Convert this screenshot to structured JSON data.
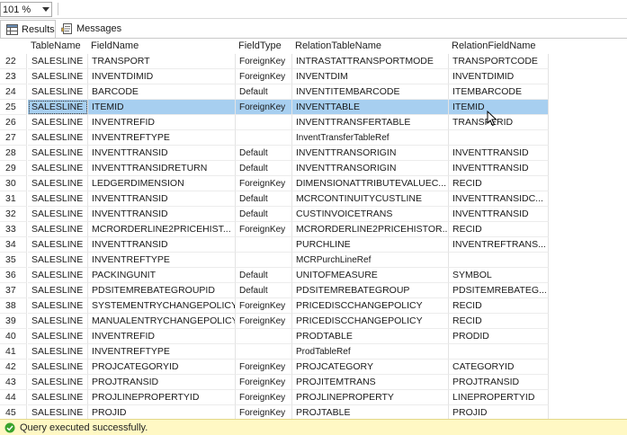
{
  "zoom": {
    "value": "101 %"
  },
  "tabs": {
    "results": "Results",
    "messages": "Messages"
  },
  "columns": [
    "TableName",
    "FieldName",
    "FieldType",
    "RelationTableName",
    "RelationFieldName"
  ],
  "rows": [
    {
      "n": "22",
      "t": "SALESLINE",
      "f": "TRANSPORT",
      "ft": "ForeignKey",
      "rt": "INTRASTATTRANSPORTMODE",
      "rf": "TRANSPORTCODE"
    },
    {
      "n": "23",
      "t": "SALESLINE",
      "f": "INVENTDIMID",
      "ft": "ForeignKey",
      "rt": "INVENTDIM",
      "rf": "INVENTDIMID"
    },
    {
      "n": "24",
      "t": "SALESLINE",
      "f": "BARCODE",
      "ft": "Default",
      "rt": "INVENTITEMBARCODE",
      "rf": "ITEMBARCODE"
    },
    {
      "n": "25",
      "t": "SALESLINE",
      "f": "ITEMID",
      "ft": "ForeignKey",
      "rt": "INVENTTABLE",
      "rf": "ITEMID",
      "sel": true
    },
    {
      "n": "26",
      "t": "SALESLINE",
      "f": "INVENTREFID",
      "ft": "",
      "rt": "INVENTTRANSFERTABLE",
      "rf": "TRANSFERID"
    },
    {
      "n": "27",
      "t": "SALESLINE",
      "f": "INVENTREFTYPE",
      "ft": "",
      "rt": "InventTransferTableRef",
      "rf": ""
    },
    {
      "n": "28",
      "t": "SALESLINE",
      "f": "INVENTTRANSID",
      "ft": "Default",
      "rt": "INVENTTRANSORIGIN",
      "rf": "INVENTTRANSID"
    },
    {
      "n": "29",
      "t": "SALESLINE",
      "f": "INVENTTRANSIDRETURN",
      "ft": "Default",
      "rt": "INVENTTRANSORIGIN",
      "rf": "INVENTTRANSID"
    },
    {
      "n": "30",
      "t": "SALESLINE",
      "f": "LEDGERDIMENSION",
      "ft": "ForeignKey",
      "rt": "DIMENSIONATTRIBUTEVALUEC...",
      "rf": "RECID"
    },
    {
      "n": "31",
      "t": "SALESLINE",
      "f": "INVENTTRANSID",
      "ft": "Default",
      "rt": "MCRCONTINUITYCUSTLINE",
      "rf": "INVENTTRANSIDC..."
    },
    {
      "n": "32",
      "t": "SALESLINE",
      "f": "INVENTTRANSID",
      "ft": "Default",
      "rt": "CUSTINVOICETRANS",
      "rf": "INVENTTRANSID"
    },
    {
      "n": "33",
      "t": "SALESLINE",
      "f": "MCRORDERLINE2PRICEHIST...",
      "ft": "ForeignKey",
      "rt": "MCRORDERLINE2PRICEHISTOR...",
      "rf": "RECID"
    },
    {
      "n": "34",
      "t": "SALESLINE",
      "f": "INVENTTRANSID",
      "ft": "",
      "rt": "PURCHLINE",
      "rf": "INVENTREFTRANS..."
    },
    {
      "n": "35",
      "t": "SALESLINE",
      "f": "INVENTREFTYPE",
      "ft": "",
      "rt": "MCRPurchLineRef",
      "rf": ""
    },
    {
      "n": "36",
      "t": "SALESLINE",
      "f": "PACKINGUNIT",
      "ft": "Default",
      "rt": "UNITOFMEASURE",
      "rf": "SYMBOL"
    },
    {
      "n": "37",
      "t": "SALESLINE",
      "f": "PDSITEMREBATEGROUPID",
      "ft": "Default",
      "rt": "PDSITEMREBATEGROUP",
      "rf": "PDSITEMREBATEG..."
    },
    {
      "n": "38",
      "t": "SALESLINE",
      "f": "SYSTEMENTRYCHANGEPOLICY",
      "ft": "ForeignKey",
      "rt": "PRICEDISCCHANGEPOLICY",
      "rf": "RECID"
    },
    {
      "n": "39",
      "t": "SALESLINE",
      "f": "MANUALENTRYCHANGEPOLICY",
      "ft": "ForeignKey",
      "rt": "PRICEDISCCHANGEPOLICY",
      "rf": "RECID"
    },
    {
      "n": "40",
      "t": "SALESLINE",
      "f": "INVENTREFID",
      "ft": "",
      "rt": "PRODTABLE",
      "rf": "PRODID"
    },
    {
      "n": "41",
      "t": "SALESLINE",
      "f": "INVENTREFTYPE",
      "ft": "",
      "rt": "ProdTableRef",
      "rf": ""
    },
    {
      "n": "42",
      "t": "SALESLINE",
      "f": "PROJCATEGORYID",
      "ft": "ForeignKey",
      "rt": "PROJCATEGORY",
      "rf": "CATEGORYID"
    },
    {
      "n": "43",
      "t": "SALESLINE",
      "f": "PROJTRANSID",
      "ft": "ForeignKey",
      "rt": "PROJITEMTRANS",
      "rf": "PROJTRANSID"
    },
    {
      "n": "44",
      "t": "SALESLINE",
      "f": "PROJLINEPROPERTYID",
      "ft": "ForeignKey",
      "rt": "PROJLINEPROPERTY",
      "rf": "LINEPROPERTYID"
    },
    {
      "n": "45",
      "t": "SALESLINE",
      "f": "PROJID",
      "ft": "ForeignKey",
      "rt": "PROJTABLE",
      "rf": "PROJID"
    }
  ],
  "status": {
    "message": "Query executed successfully."
  },
  "colors": {
    "selection": "#a7cff0",
    "status_bg": "#fff8c4",
    "ok_green": "#3aa32c"
  }
}
